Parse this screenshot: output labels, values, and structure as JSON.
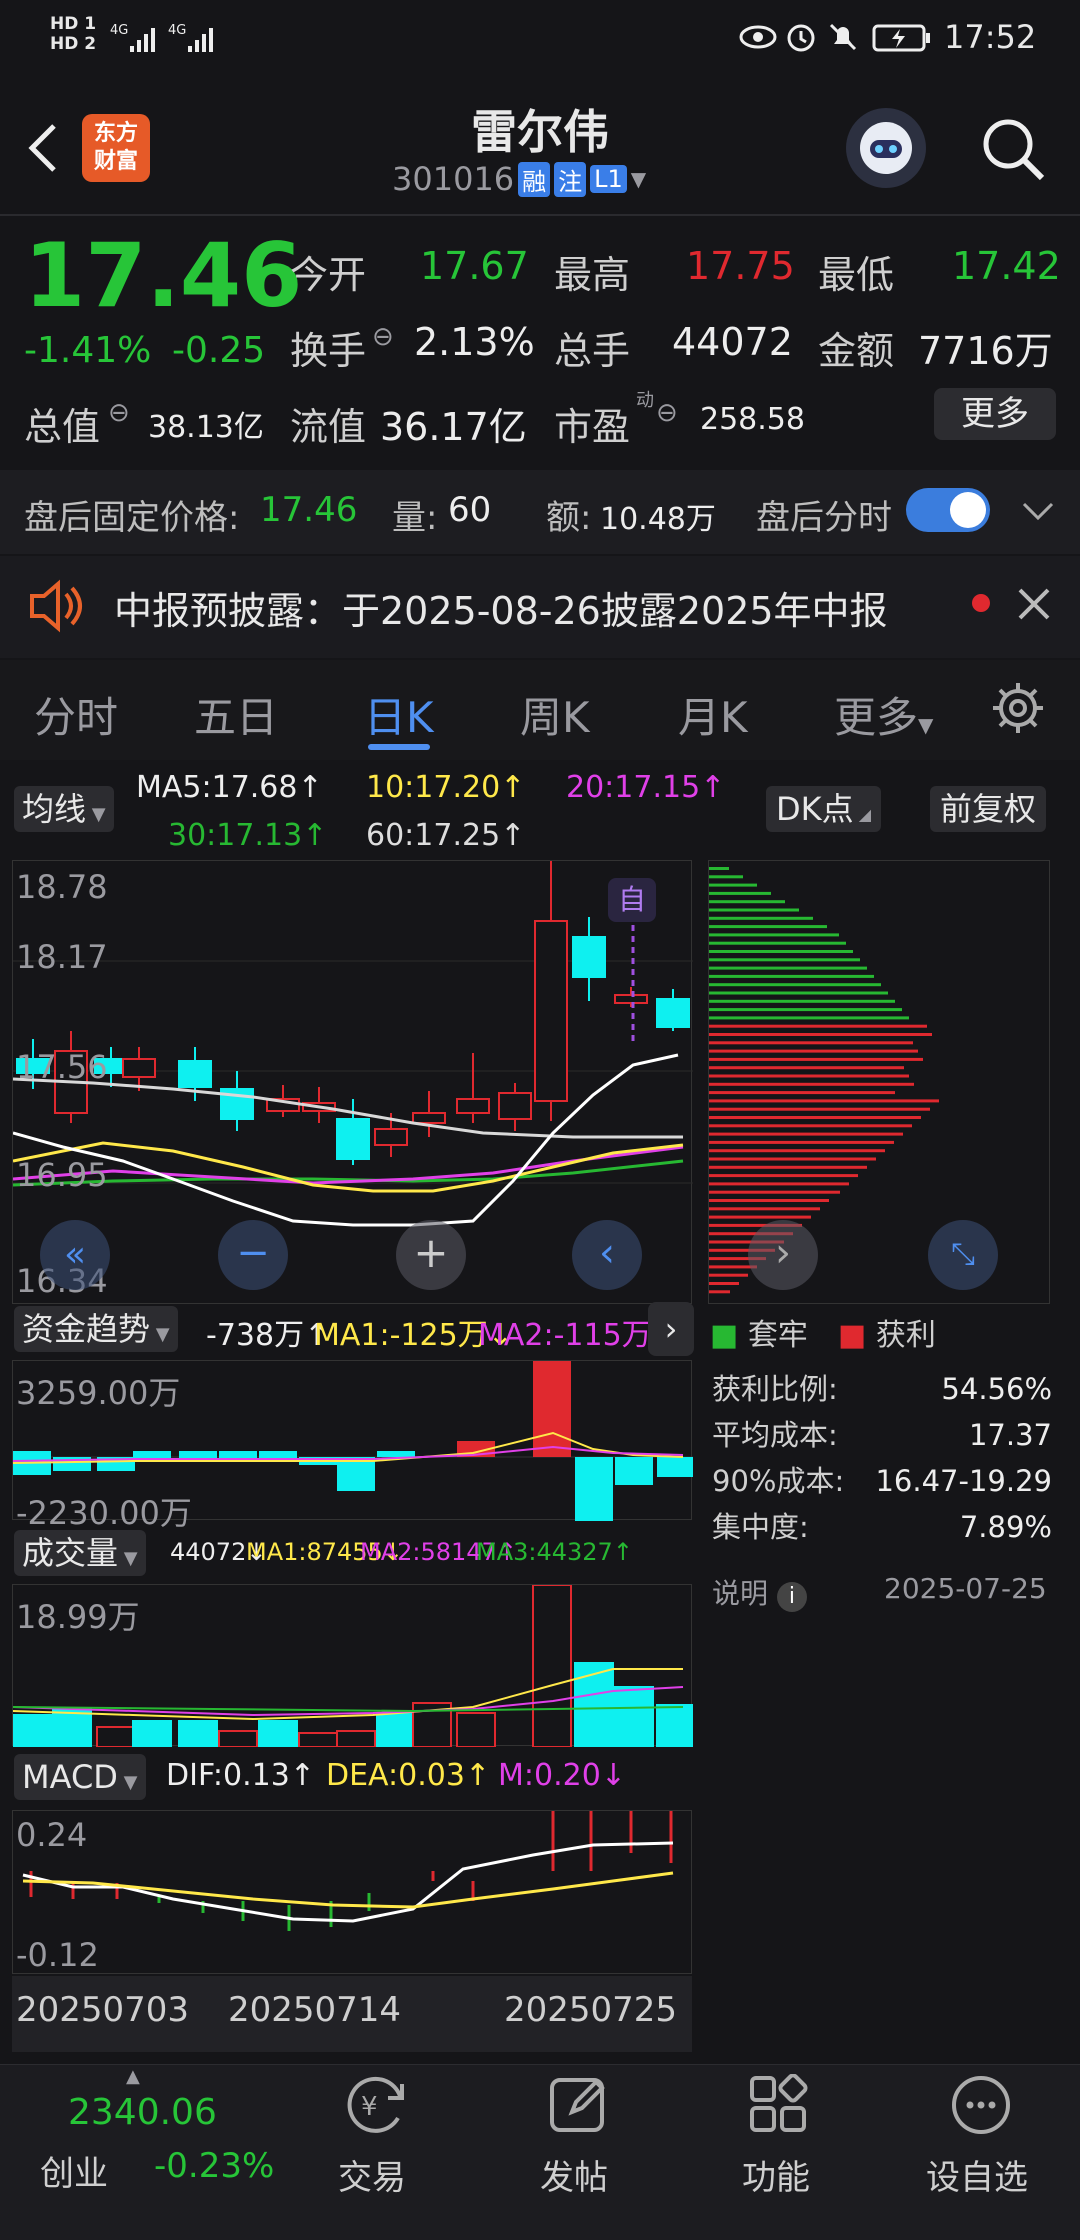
{
  "status_bar": {
    "sig1": "HD 1",
    "sig2": "HD 2",
    "net1": "4G",
    "net2": "4G",
    "time": "17:52"
  },
  "header": {
    "logo_line1": "东方",
    "logo_line2": "财富",
    "title": "雷尔伟",
    "code": "301016",
    "tag_rong": "融",
    "tag_zhu": "注",
    "tag_l1": "L1"
  },
  "quote": {
    "price": "17.46",
    "change_pct": "-1.41%",
    "change": "-0.25",
    "open_label": "今开",
    "open": "17.67",
    "high_label": "最高",
    "high": "17.75",
    "low_label": "最低",
    "low": "17.42",
    "turnover_label": "换手",
    "turnover": "2.13%",
    "vol_label": "总手",
    "vol": "44072",
    "amount_label": "金额",
    "amount": "7716万",
    "mcap_label": "总值",
    "mcap": "38.13亿",
    "float_label": "流值",
    "float_cap": "36.17亿",
    "pe_label": "市盈",
    "pe_sup": "动",
    "pe": "258.58",
    "more": "更多"
  },
  "after_hours": {
    "label": "盘后固定价格:",
    "price": "17.46",
    "vol_label": "量:",
    "vol": "60",
    "amt_label": "额:",
    "amt": "10.48万",
    "switch_label": "盘后分时"
  },
  "notice": {
    "text": "中报预披露：于2025-08-26披露2025年中报"
  },
  "tabs": [
    "分时",
    "五日",
    "日K",
    "周K",
    "月K",
    "更多"
  ],
  "indicators": {
    "ma_btn": "均线",
    "ma5": "MA5:17.68↑",
    "ma10": "10:17.20↑",
    "ma20": "20:17.15↑",
    "ma30": "30:17.13↑",
    "ma60": "60:17.25↑",
    "dk_btn": "DK点",
    "fq_btn": "前复权"
  },
  "kchart": {
    "y1": "18.78",
    "y2": "18.17",
    "y3": "17.56",
    "y4": "16.95",
    "y5": "16.34",
    "self_tag": "自"
  },
  "fund": {
    "btn": "资金趋势",
    "val": "-738万↑",
    "ma1": "MA1:-125万↓",
    "ma2": "MA2:-115万↓",
    "top": "3259.00万",
    "bottom": "-2230.00万"
  },
  "volume": {
    "btn": "成交量",
    "val": "44072↓",
    "ma1": "MA1:87455↓",
    "ma2": "MA2:58147↑",
    "ma3": "MA3:44327↑",
    "top": "18.99万"
  },
  "macd": {
    "btn": "MACD",
    "dif": "DIF:0.13↑",
    "dea": "DEA:0.03↑",
    "m": "M:0.20↓",
    "top": "0.24",
    "bottom": "-0.12"
  },
  "dates": [
    "20250703",
    "20250714",
    "20250725"
  ],
  "chips": {
    "legend_tao": "套牢",
    "legend_huo": "获利",
    "rows": [
      {
        "label": "获利比例:",
        "value": "54.56%"
      },
      {
        "label": "平均成本:",
        "value": "17.37"
      },
      {
        "label": "90%成本:",
        "value": "16.47-19.29"
      },
      {
        "label": "集中度:",
        "value": "7.89%"
      }
    ],
    "note": "说明",
    "date": "2025-07-25"
  },
  "bottom_nav": {
    "index_val": "2340.06",
    "index_name": "创业",
    "index_chg": "-0.23%",
    "trade": "交易",
    "post": "发帖",
    "func": "功能",
    "fav": "设自选"
  }
}
